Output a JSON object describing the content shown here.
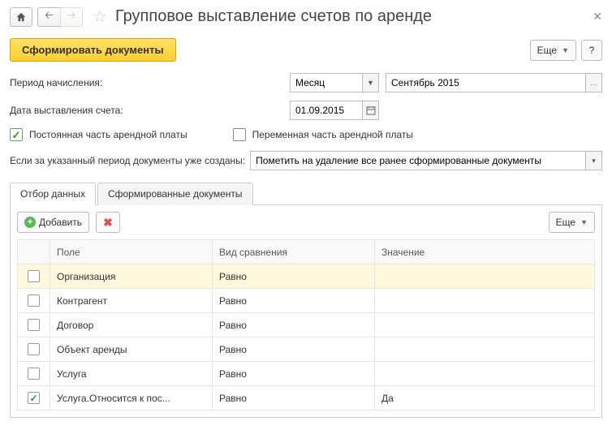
{
  "header": {
    "title": "Групповое выставление счетов по аренде"
  },
  "toolbar": {
    "primary": "Сформировать документы",
    "more": "Еще",
    "help": "?"
  },
  "form": {
    "period_label": "Период начисления:",
    "period_type": "Месяц",
    "period_value": "Сентябрь 2015",
    "date_label": "Дата выставления счета:",
    "date_value": "01.09.2015",
    "chk_fixed_label": "Постоянная часть арендной платы",
    "chk_fixed": true,
    "chk_var_label": "Переменная часть арендной платы",
    "chk_var": false,
    "exist_label": "Если за указанный период документы уже созданы:",
    "exist_value": "Пометить на удаление все ранее сформированные документы"
  },
  "tabs": {
    "t1": "Отбор данных",
    "t2": "Сформированные документы"
  },
  "panel": {
    "add": "Добавить",
    "more": "Еще"
  },
  "grid": {
    "col_field": "Поле",
    "col_cmp": "Вид сравнения",
    "col_val": "Значение",
    "rows": [
      {
        "on": false,
        "field": "Организация",
        "cmp": "Равно",
        "val": "",
        "hl": true
      },
      {
        "on": false,
        "field": "Контрагент",
        "cmp": "Равно",
        "val": ""
      },
      {
        "on": false,
        "field": "Договор",
        "cmp": "Равно",
        "val": ""
      },
      {
        "on": false,
        "field": "Объект аренды",
        "cmp": "Равно",
        "val": ""
      },
      {
        "on": false,
        "field": "Услуга",
        "cmp": "Равно",
        "val": ""
      },
      {
        "on": true,
        "field": "Услуга.Относится к пос...",
        "cmp": "Равно",
        "val": "Да"
      }
    ]
  }
}
